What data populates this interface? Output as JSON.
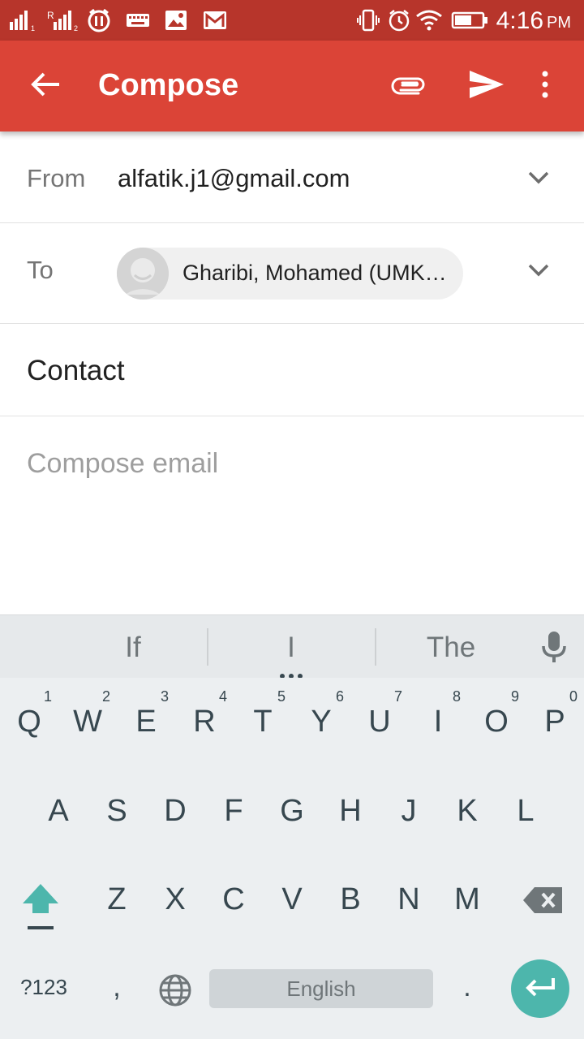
{
  "status_bar": {
    "time": "4:16",
    "ampm": "PM",
    "icons": [
      "signal-sim1-icon",
      "signal-sim2-icon",
      "pause-icon",
      "keyboard-icon",
      "image-icon",
      "gmail-icon",
      "vibrate-icon",
      "alarm-icon",
      "wifi-icon",
      "battery-icon"
    ]
  },
  "app_bar": {
    "title": "Compose",
    "accent": "#db4437",
    "actions": [
      "back-arrow-icon",
      "attach-icon",
      "send-icon",
      "more-vert-icon"
    ]
  },
  "form": {
    "from_label": "From",
    "from_value": "alfatik.j1@gmail.com",
    "to_label": "To",
    "to_recipient": "Gharibi, Mohamed (UMK…",
    "subject": "Contact",
    "body_placeholder": "Compose email"
  },
  "keyboard": {
    "suggestions": [
      "If",
      "I",
      "The"
    ],
    "row1": [
      {
        "key": "Q",
        "hint": "1"
      },
      {
        "key": "W",
        "hint": "2"
      },
      {
        "key": "E",
        "hint": "3"
      },
      {
        "key": "R",
        "hint": "4"
      },
      {
        "key": "T",
        "hint": "5"
      },
      {
        "key": "Y",
        "hint": "6"
      },
      {
        "key": "U",
        "hint": "7"
      },
      {
        "key": "I",
        "hint": "8"
      },
      {
        "key": "O",
        "hint": "9"
      },
      {
        "key": "P",
        "hint": "0"
      }
    ],
    "row2": [
      "A",
      "S",
      "D",
      "F",
      "G",
      "H",
      "J",
      "K",
      "L"
    ],
    "row3": [
      "Z",
      "X",
      "C",
      "V",
      "B",
      "N",
      "M"
    ],
    "symbols_key": "?123",
    "comma_key": ",",
    "period_key": ".",
    "space_label": "English",
    "accent": "#4db6ac"
  }
}
